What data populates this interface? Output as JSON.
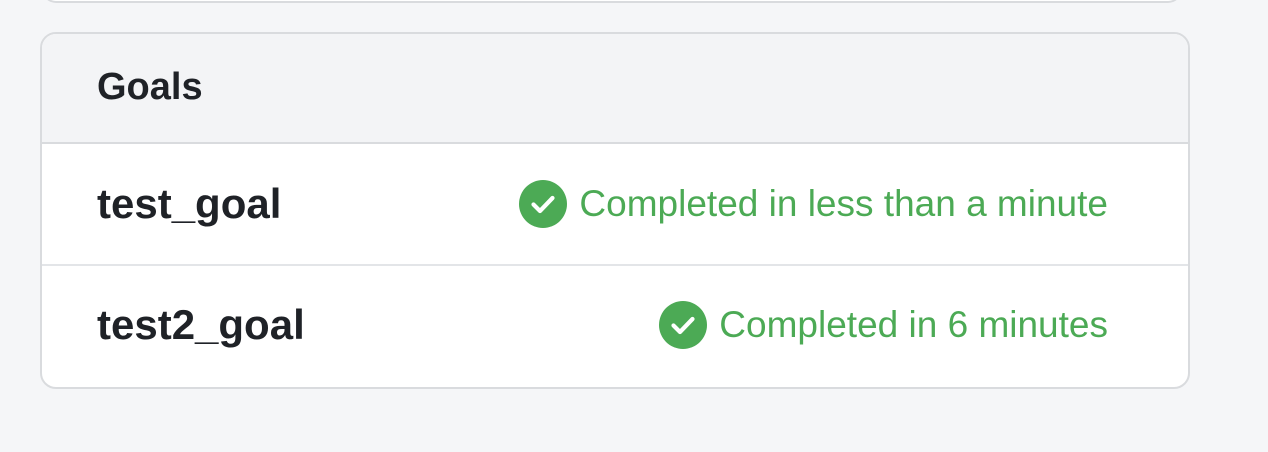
{
  "panel": {
    "title": "Goals"
  },
  "goals": [
    {
      "name": "test_goal",
      "status": "Completed in less than a minute",
      "status_icon": "check-circle-icon"
    },
    {
      "name": "test2_goal",
      "status": "Completed in 6 minutes",
      "status_icon": "check-circle-icon"
    }
  ],
  "colors": {
    "background": "#f5f6f8",
    "card_border": "#d9dbde",
    "header_bg": "#f3f4f6",
    "text_primary": "#1f2227",
    "success": "#4caa55"
  }
}
